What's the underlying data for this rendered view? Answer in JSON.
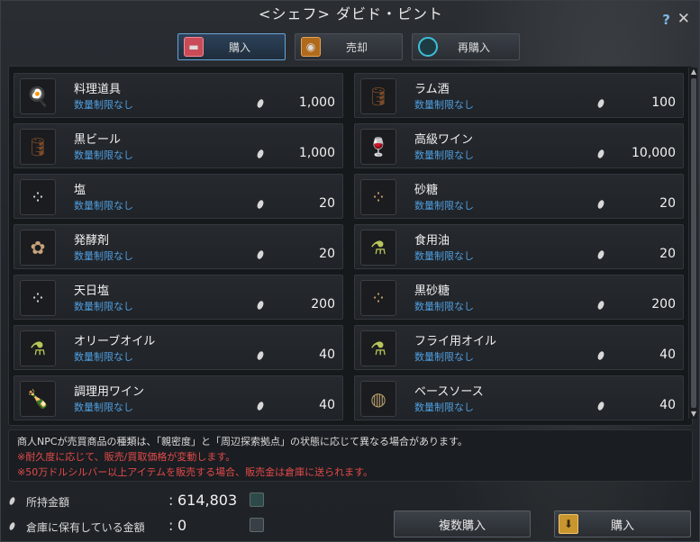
{
  "window": {
    "title": "<シェフ> ダビド・ピント"
  },
  "tabs": [
    {
      "label": "購入",
      "icon": "bag-icon",
      "active": true
    },
    {
      "label": "売却",
      "icon": "coins-icon",
      "active": false
    },
    {
      "label": "再購入",
      "icon": "refresh-icon",
      "active": false
    }
  ],
  "items": [
    {
      "name": "料理道具",
      "limit": "数量制限なし",
      "price": "1,000",
      "icon": "cooking-utensils-icon"
    },
    {
      "name": "ラム酒",
      "limit": "数量制限なし",
      "price": "100",
      "icon": "barrel-icon"
    },
    {
      "name": "黒ビール",
      "limit": "数量制限なし",
      "price": "1,000",
      "icon": "barrel-icon"
    },
    {
      "name": "高級ワイン",
      "limit": "数量制限なし",
      "price": "10,000",
      "icon": "wine-glass-icon"
    },
    {
      "name": "塩",
      "limit": "数量制限なし",
      "price": "20",
      "icon": "salt-pile-icon"
    },
    {
      "name": "砂糖",
      "limit": "数量制限なし",
      "price": "20",
      "icon": "sugar-pile-icon"
    },
    {
      "name": "発酵剤",
      "limit": "数量制限なし",
      "price": "20",
      "icon": "yeast-icon"
    },
    {
      "name": "食用油",
      "limit": "数量制限なし",
      "price": "20",
      "icon": "oil-flask-icon"
    },
    {
      "name": "天日塩",
      "limit": "数量制限なし",
      "price": "200",
      "icon": "salt-pile-icon"
    },
    {
      "name": "黒砂糖",
      "limit": "数量制限なし",
      "price": "200",
      "icon": "sugar-pile-icon"
    },
    {
      "name": "オリーブオイル",
      "limit": "数量制限なし",
      "price": "40",
      "icon": "oil-flask-icon"
    },
    {
      "name": "フライ用オイル",
      "limit": "数量制限なし",
      "price": "40",
      "icon": "oil-flask-icon"
    },
    {
      "name": "調理用ワイン",
      "limit": "数量制限なし",
      "price": "40",
      "icon": "wine-bottle-icon"
    },
    {
      "name": "ベースソース",
      "limit": "数量制限なし",
      "price": "40",
      "icon": "sauce-bowl-icon"
    }
  ],
  "notice": {
    "line1": "商人NPCが売買商品の種類は、「親密度」と「周辺探索拠点」の状態に応じて異なる場合があります。",
    "line2": "※耐久度に応じて、販売/買取価格が変動します。",
    "line3": "※50万ドルシルバー以上アイテムを販売する場合、販売金は倉庫に送られます。"
  },
  "money": {
    "owned_label": "所持金額",
    "owned_value": "614,803",
    "warehouse_label": "倉庫に保有している金額",
    "warehouse_value": "0",
    "colon": ":"
  },
  "buttons": {
    "multi_buy": "複数購入",
    "buy": "購入"
  },
  "colors": {
    "limit_text": "#4f9ee0",
    "warning_text": "#e34a4a",
    "active_tab_border": "#6aa3d6"
  }
}
